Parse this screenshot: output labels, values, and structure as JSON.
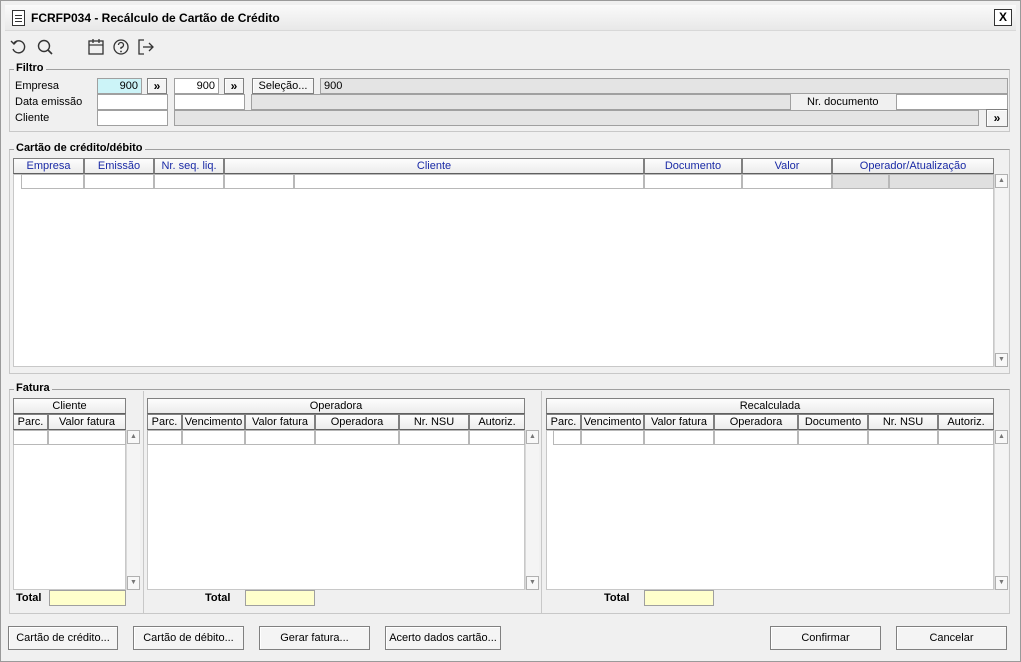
{
  "window": {
    "title": "FCRFP034 - Recálculo de Cartão de Crédito",
    "close_label": "X"
  },
  "toolbar": {
    "icons": [
      "undo-icon",
      "search-icon",
      "calendar-icon",
      "help-icon",
      "exit-icon"
    ]
  },
  "filtro": {
    "title": "Filtro",
    "empresa_label": "Empresa",
    "empresa_from": "900",
    "empresa_to": "900",
    "expand_label": "»",
    "selecao_label": "Seleção...",
    "empresa_name": "900",
    "data_emissao_label": "Data emissão",
    "data_emissao_from": "",
    "data_emissao_to": "",
    "nr_documento_label": "Nr. documento",
    "nr_documento_value": "",
    "cliente_label": "Cliente",
    "cliente_code": "",
    "cliente_name": ""
  },
  "cartao": {
    "title": "Cartão de crédito/débito",
    "columns": [
      "Empresa",
      "Emissão",
      "Nr. seq. liq.",
      "Cliente",
      "Documento",
      "Valor",
      "Operador/Atualização"
    ]
  },
  "fatura": {
    "title": "Fatura",
    "cliente": {
      "title": "Cliente",
      "columns": [
        "Parc.",
        "Valor fatura"
      ],
      "total_label": "Total",
      "total_value": ""
    },
    "operadora": {
      "title": "Operadora",
      "columns": [
        "Parc.",
        "Vencimento",
        "Valor fatura",
        "Operadora",
        "Nr. NSU",
        "Autoriz."
      ],
      "total_label": "Total",
      "total_value": ""
    },
    "recalculada": {
      "title": "Recalculada",
      "columns": [
        "Parc.",
        "Vencimento",
        "Valor fatura",
        "Operadora",
        "Documento",
        "Nr. NSU",
        "Autoriz."
      ],
      "total_label": "Total",
      "total_value": ""
    }
  },
  "footer": {
    "cartao_credito": "Cartão de crédito...",
    "cartao_debito": "Cartão de débito...",
    "gerar_fatura": "Gerar fatura...",
    "acerto_dados": "Acerto dados cartão...",
    "confirmar": "Confirmar",
    "cancelar": "Cancelar"
  },
  "colors": {
    "highlight_field": "#ccf4f8",
    "total_field": "#ffffcc",
    "header_text_blue": "#1a2aa6"
  }
}
